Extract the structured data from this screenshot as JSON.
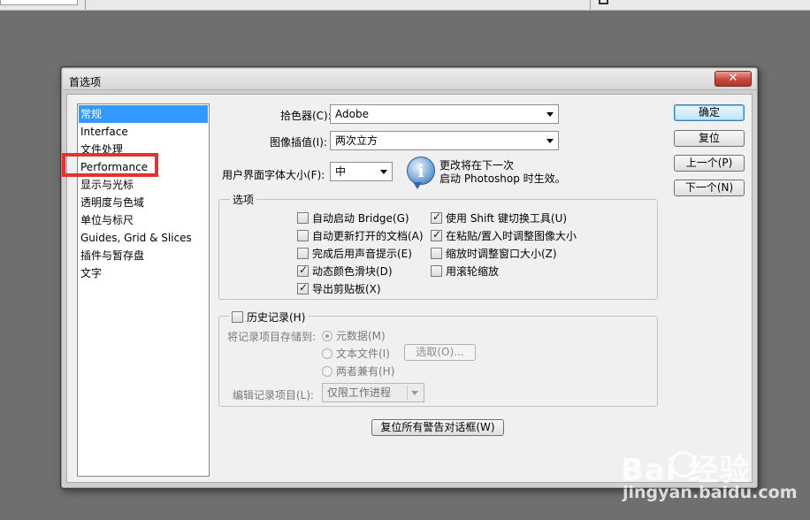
{
  "dialog": {
    "title": "首选项",
    "close": "✕"
  },
  "nav": {
    "items": [
      {
        "label": "常规",
        "selected": true
      },
      {
        "label": "Interface"
      },
      {
        "label": "文件处理"
      },
      {
        "label": "Performance"
      },
      {
        "label": "显示与光标"
      },
      {
        "label": "透明度与色域"
      },
      {
        "label": "单位与标尺"
      },
      {
        "label": "Guides, Grid & Slices"
      },
      {
        "label": "插件与暂存盘"
      },
      {
        "label": "文字"
      }
    ]
  },
  "general": {
    "color_picker_label": "拾色器(C):",
    "color_picker_value": "Adobe",
    "interpolation_label": "图像插值(I):",
    "interpolation_value": "两次立方",
    "ui_font_label": "用户界面字体大小(F):",
    "ui_font_value": "中",
    "info_icon": "i",
    "info_line1": "更改将在下一次",
    "info_line2": "启动 Photoshop 时生效。"
  },
  "options": {
    "legend": "选项",
    "auto_bridge": {
      "label": "自动启动 Bridge(G)",
      "checked": false
    },
    "auto_update": {
      "label": "自动更新打开的文档(A)",
      "checked": false
    },
    "beep": {
      "label": "完成后用声音提示(E)",
      "checked": false
    },
    "dynamic_sliders": {
      "label": "动态颜色滑块(D)",
      "checked": true
    },
    "export_clipboard": {
      "label": "导出剪贴板(X)",
      "checked": true
    },
    "shift_tool": {
      "label": "使用 Shift 键切换工具(U)",
      "checked": true
    },
    "resize_paste": {
      "label": "在粘贴/置入时调整图像大小",
      "checked": true
    },
    "zoom_resize": {
      "label": "缩放时调整窗口大小(Z)",
      "checked": false
    },
    "scroll_zoom": {
      "label": "用滚轮缩放",
      "checked": false
    }
  },
  "history": {
    "legend": "历史记录(H)",
    "checked": false,
    "save_to_label": "将记录项目存储到:",
    "metadata": "元数据(M)",
    "text_file": "文本文件(I)",
    "both": "两者兼有(H)",
    "choose_button": "选取(O)...",
    "edit_log_label": "编辑记录项目(L):",
    "edit_log_value": "仅限工作进程"
  },
  "reset_warnings": "复位所有警告对话框(W)",
  "buttons": {
    "ok": "确定",
    "reset": "复位",
    "prev": "上一个(P)",
    "next": "下一个(N)"
  },
  "watermark": {
    "brand": "Bai  经验",
    "url": "jingyan.baidu.com"
  },
  "colors": {
    "selection": "#3399ff",
    "callout": "#e8302e",
    "close_button": "#c9463c"
  }
}
